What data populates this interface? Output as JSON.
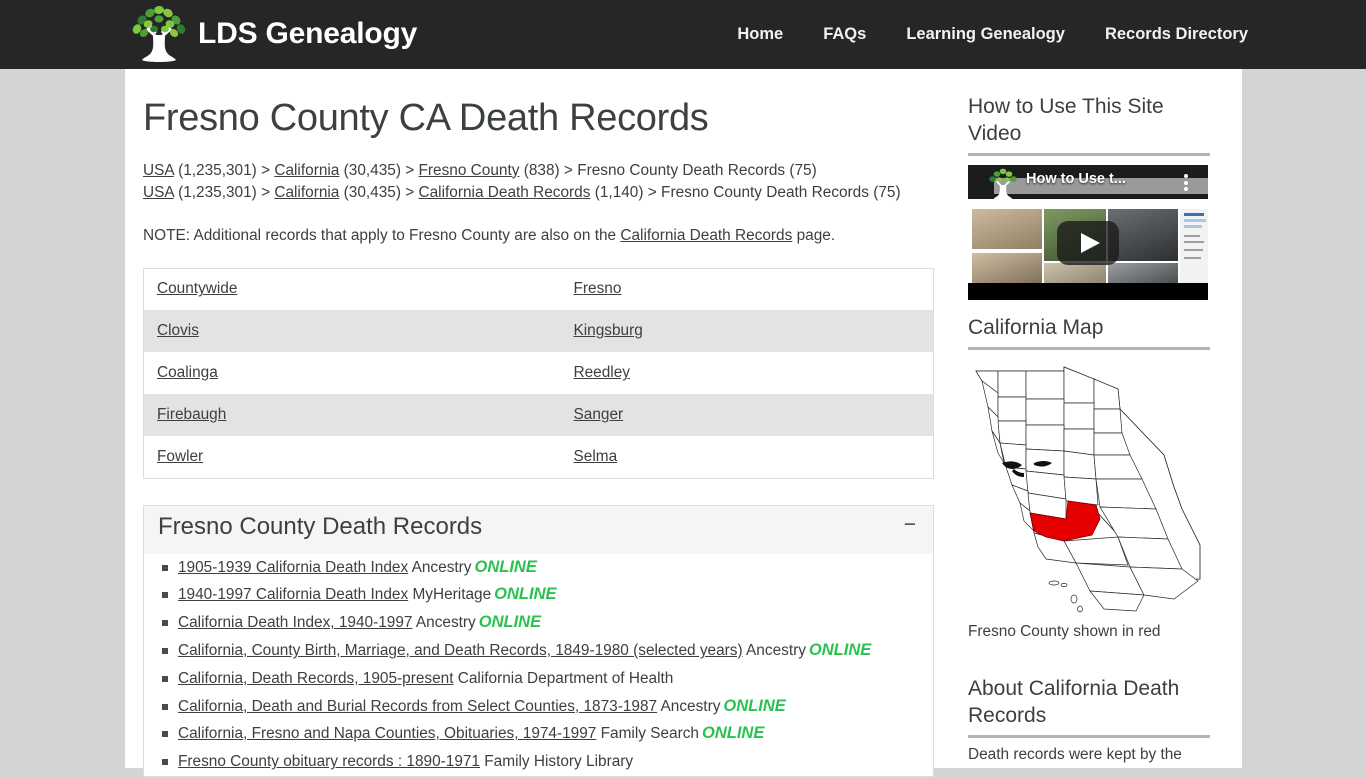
{
  "site": {
    "logo_text": "LDS Genealogy",
    "logo_icon": "tree-logo-icon"
  },
  "nav": {
    "items": [
      {
        "label": "Home"
      },
      {
        "label": "FAQs"
      },
      {
        "label": "Learning Genealogy"
      },
      {
        "label": "Records Directory"
      }
    ]
  },
  "main": {
    "title": "Fresno County CA Death Records",
    "breadcrumb1": {
      "usa": "USA",
      "usa_count": " (1,235,301) > ",
      "state": "California",
      "state_count": " (30,435) > ",
      "county": "Fresno County",
      "county_count": " (838) > ",
      "current": "Fresno County Death Records (75)"
    },
    "breadcrumb2": {
      "usa": "USA",
      "usa_count": " (1,235,301) > ",
      "state": "California",
      "state_count": " (30,435) > ",
      "cadeath": "California Death Records",
      "cadeath_count": " (1,140) > ",
      "current": "Fresno County Death Records (75)"
    },
    "note": {
      "before": "NOTE: Additional records that apply to Fresno County are also on the ",
      "link": "California Death Records",
      "after": " page."
    },
    "city_table": {
      "rows": [
        {
          "left": "Countywide",
          "right": "Fresno"
        },
        {
          "left": "Clovis",
          "right": "Kingsburg"
        },
        {
          "left": "Coalinga",
          "right": "Reedley"
        },
        {
          "left": "Firebaugh",
          "right": "Sanger"
        },
        {
          "left": "Fowler",
          "right": "Selma"
        }
      ]
    },
    "panel": {
      "title": "Fresno County Death Records",
      "toggle": "−",
      "records": [
        {
          "link": "1905-1939 California Death Index",
          "source": "Ancestry",
          "badge": "ONLINE"
        },
        {
          "link": "1940-1997 California Death Index",
          "source": "MyHeritage",
          "badge": "ONLINE"
        },
        {
          "link": "California Death Index, 1940-1997",
          "source": "Ancestry",
          "badge": "ONLINE"
        },
        {
          "link": "California, County Birth, Marriage, and Death Records, 1849-1980 (selected years)",
          "source": "Ancestry",
          "badge": "ONLINE"
        },
        {
          "link": "California, Death Records, 1905-present",
          "source": "California Department of Health",
          "badge": ""
        },
        {
          "link": "California, Death and Burial Records from Select Counties, 1873-1987",
          "source": "Ancestry",
          "badge": "ONLINE"
        },
        {
          "link": "California, Fresno and Napa Counties, Obituaries, 1974-1997",
          "source": "Family Search",
          "badge": "ONLINE"
        },
        {
          "link": "Fresno County obituary records : 1890-1971",
          "source": "Family History Library",
          "badge": ""
        }
      ]
    }
  },
  "sidebar": {
    "video_heading": "How to Use This Site Video",
    "video_overlay_title": "How to Use t...",
    "map_heading": "California Map",
    "map_caption": "Fresno County shown in red",
    "about_heading": "About California Death Records",
    "about_text": "Death records were kept by the"
  },
  "colors": {
    "header_bg": "#262626",
    "page_bg": "#d4d4d4",
    "text": "#3c4043",
    "online_green": "#2ac24f",
    "county_red": "#e60000",
    "row_alt": "#e3e3e3"
  }
}
